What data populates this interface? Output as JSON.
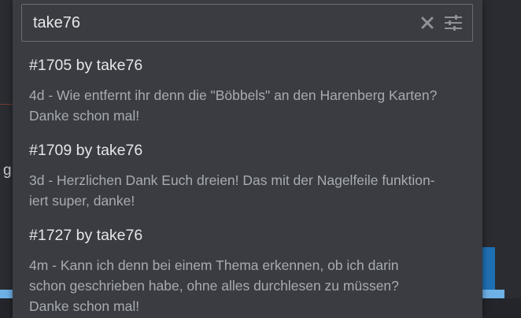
{
  "background": {
    "left_fragment": "g"
  },
  "search": {
    "value": "take76",
    "placeholder": ""
  },
  "icons": {
    "clear": "close-icon",
    "filter": "sliders-icon"
  },
  "results": [
    {
      "title": "#1705 by take76",
      "snippet_lines": [
        "4d - Wie entfernt ihr denn die \"Böbbels\" an den Harenberg Karten?",
        "Danke schon mal!"
      ]
    },
    {
      "title": "#1709 by take76",
      "snippet_lines": [
        "3d - Herzlichen Dank Euch dreien! Das mit der Nagelfeile funktion-",
        "iert super, danke!"
      ]
    },
    {
      "title": "#1727 by take76",
      "snippet_lines": [
        "4m - Kann ich denn bei einem Thema erkennen, ob ich darin",
        "schon geschrieben habe, ohne alles durchlesen zu müssen?",
        "Danke schon mal!"
      ]
    }
  ]
}
